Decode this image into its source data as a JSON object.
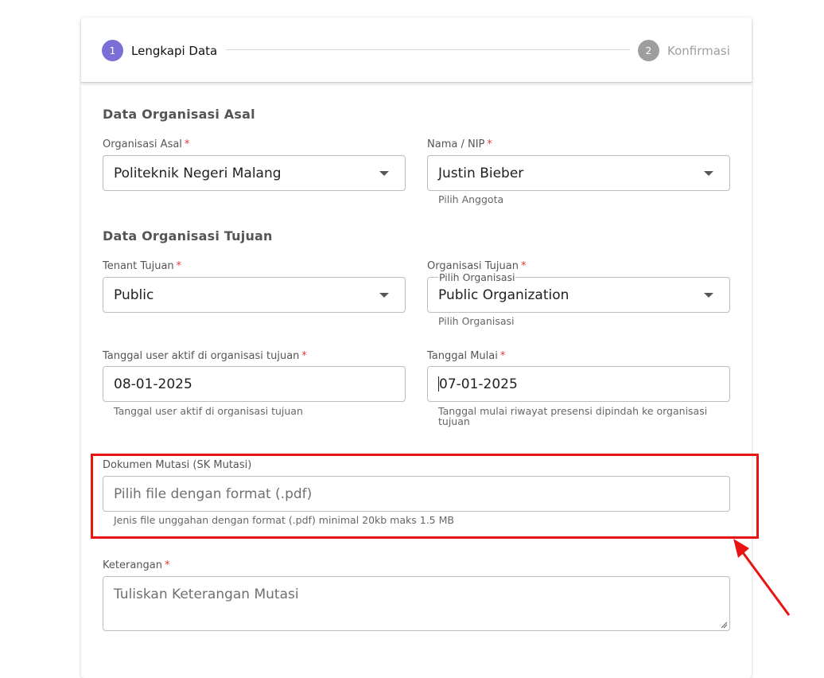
{
  "stepper": {
    "steps": [
      {
        "number": "1",
        "label": "Lengkapi Data"
      },
      {
        "number": "2",
        "label": "Konfirmasi"
      }
    ]
  },
  "sections": {
    "asal_title": "Data Organisasi Asal",
    "tujuan_title": "Data Organisasi Tujuan"
  },
  "fields": {
    "organisasi_asal": {
      "label": "Organisasi Asal",
      "required": "*",
      "value": "Politeknik Negeri Malang"
    },
    "nama_nip": {
      "label": "Nama / NIP",
      "required": "*",
      "value": "Justin Bieber",
      "hint": "Pilih Anggota"
    },
    "tenant_tujuan": {
      "label": "Tenant Tujuan",
      "required": "*",
      "value": "Public"
    },
    "organisasi_tujuan": {
      "label": "Organisasi Tujuan",
      "required": "*",
      "floating_label": "Pilih Organisasi",
      "value": "Public Organization",
      "hint": "Pilih Organisasi"
    },
    "tanggal_aktif": {
      "label": "Tanggal user aktif di organisasi tujuan",
      "required": "*",
      "value": "08-01-2025",
      "hint": "Tanggal user aktif di organisasi tujuan"
    },
    "tanggal_mulai": {
      "label": "Tanggal Mulai",
      "required": "*",
      "value": "07-01-2025",
      "hint_line1": "Tanggal mulai riwayat presensi dipindah ke organisasi",
      "hint_line2": "tujuan"
    },
    "dokumen_mutasi": {
      "label": "Dokumen Mutasi (SK Mutasi)",
      "placeholder": "Pilih file dengan format (.pdf)",
      "hint": "Jenis file unggahan dengan format (.pdf) minimal 20kb maks 1.5 MB"
    },
    "keterangan": {
      "label": "Keterangan",
      "required": "*",
      "placeholder": "Tuliskan Keterangan Mutasi"
    }
  },
  "colors": {
    "accent": "#7b6fd6",
    "required": "#e53935",
    "annotation": "#e81313"
  }
}
